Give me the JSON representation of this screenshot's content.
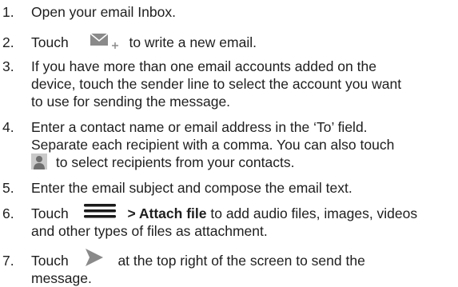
{
  "steps": [
    {
      "num": "1.",
      "lines": [
        "Open your email Inbox."
      ]
    },
    {
      "num": "2.",
      "before": "Touch",
      "after": "to write a new email.",
      "icon": "compose-mail-icon"
    },
    {
      "num": "3.",
      "lines": [
        "If you have more than one email accounts added on the",
        "device, touch the sender line to select the account you want",
        "to use for sending the message."
      ]
    },
    {
      "num": "4.",
      "lines": [
        "Enter a contact name or email address in the ‘To’ field.",
        "Separate each recipient with a comma. You can also touch"
      ],
      "last_line_after": "to select recipients from your contacts.",
      "icon": "contact-person-icon"
    },
    {
      "num": "5.",
      "lines": [
        "Enter the email subject and compose the email text."
      ]
    },
    {
      "num": "6.",
      "before": "Touch",
      "bold": "> Attach file",
      "after": "to add audio files, images, videos",
      "second_line": "and other types of files as attachment.",
      "icon": "menu-icon"
    },
    {
      "num": "7.",
      "before": "Touch",
      "after": "at the top right of the screen to send the",
      "second_line": "message.",
      "icon": "send-icon"
    }
  ],
  "colors": {
    "text": "#1e1e1e",
    "icon_gray": "#8a8a8a",
    "icon_dark": "#1a1a1a"
  }
}
